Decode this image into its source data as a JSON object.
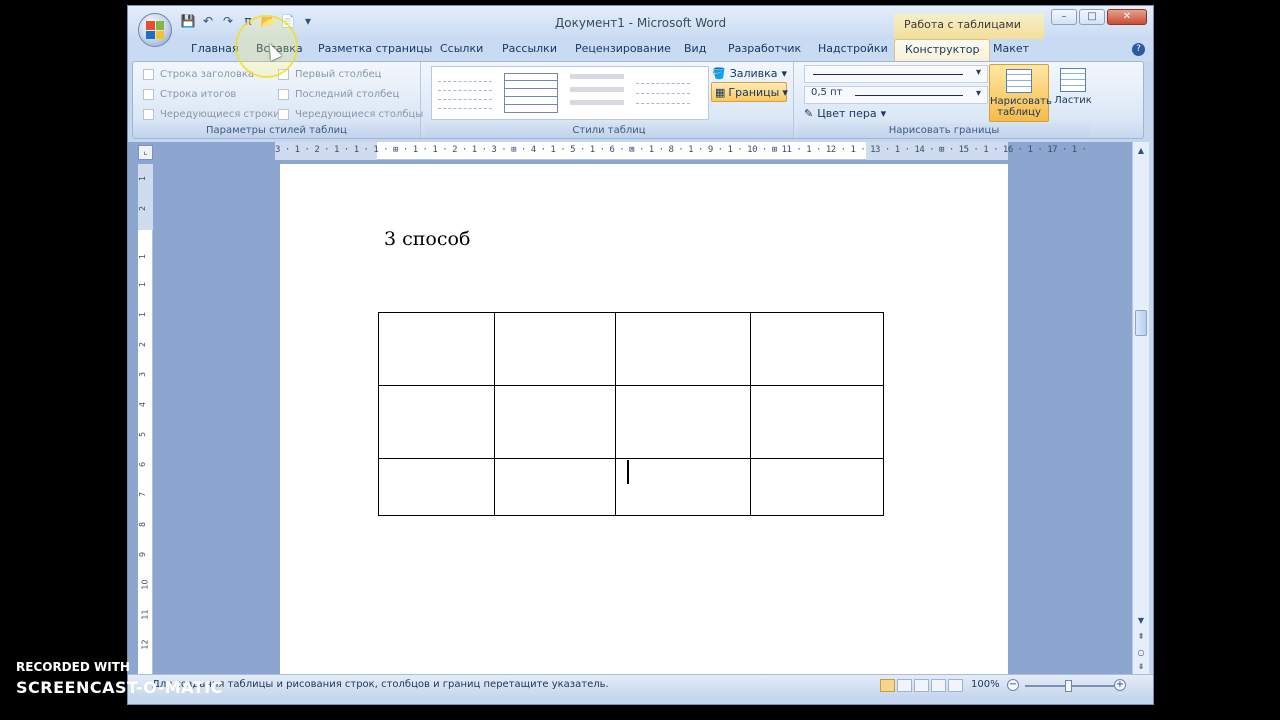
{
  "window": {
    "title": "Документ1 - Microsoft Word",
    "context_title": "Работа с таблицами"
  },
  "quick_access": [
    "💾",
    "↶",
    "↷",
    "π",
    "📂",
    "📄",
    "▾"
  ],
  "tabs": [
    "Главная",
    "Вставка",
    "Разметка страницы",
    "Ссылки",
    "Рассылки",
    "Рецензирование",
    "Вид",
    "Разработчик",
    "Надстройки",
    "Конструктор",
    "Макет"
  ],
  "active_tab": "Конструктор",
  "ribbon": {
    "style_options": {
      "label": "Параметры стилей таблиц",
      "left": [
        "Строка заголовка",
        "Строка итогов",
        "Чередующиеся строки"
      ],
      "right": [
        "Первый столбец",
        "Последний столбец",
        "Чередующиеся столбцы"
      ]
    },
    "table_styles": {
      "label": "Стили таблиц",
      "fill": "Заливка",
      "borders": "Границы"
    },
    "draw_borders": {
      "label": "Нарисовать границы",
      "line_weight": "0,5 пт",
      "pen_color": "Цвет пера",
      "draw_table": "Нарисовать таблицу",
      "eraser": "Ластик"
    }
  },
  "ruler": {
    "horizontal": "3 · 1 · 2 · 1 · 1 · 1 · ⊞ · 1 · 1 · 2 · 1 · 3 · ⊞ · 4 · 1 · 5 · 1 · 6 · ⊠ · 1 · 8 · 1 · 9 · 1 · 10 · ⊞ 11 · 1 · 12 · 1 · 13 · 1 · 14 · ⊞ · 15 · 1 · 16 · 1 · 17 · 1 ·",
    "vertical": [
      "1",
      "2",
      "1",
      "1",
      "1",
      "2",
      "3",
      "4",
      "5",
      "6",
      "7",
      "8",
      "9",
      "10",
      "11",
      "12"
    ]
  },
  "document": {
    "heading": "3 способ",
    "table": {
      "rows": 3,
      "columns": 4
    }
  },
  "status": {
    "hint": "Для создания таблицы и рисования строк, столбцов и границ перетащите указатель.",
    "zoom": "100%"
  },
  "watermark": {
    "line1": "RECORDED WITH",
    "line2": "SCREENCAST-O-MATIC"
  },
  "colors": {
    "office_logo": [
      "#e94f2d",
      "#84b842",
      "#1f6fc1",
      "#f7c12f"
    ],
    "context_tab": "#f3df9a",
    "workspace": "#8ca6d0"
  }
}
